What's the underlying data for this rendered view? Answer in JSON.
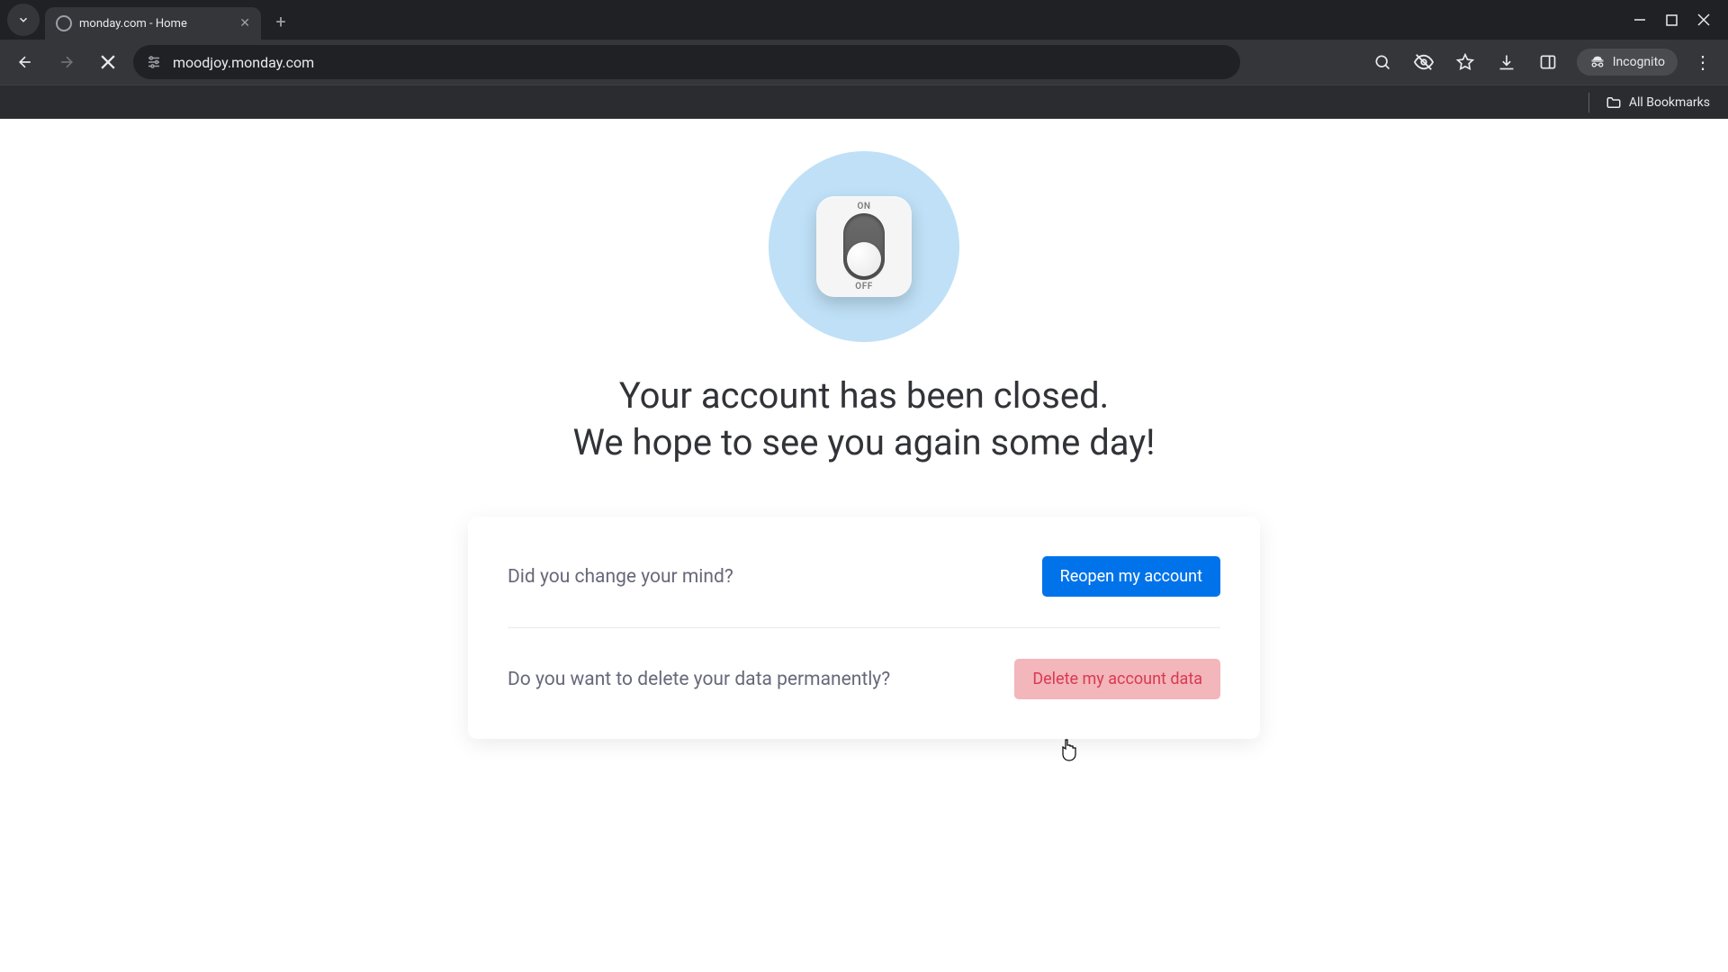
{
  "browser": {
    "tab_title": "monday.com - Home",
    "url": "moodjoy.monday.com",
    "incognito_label": "Incognito",
    "all_bookmarks_label": "All Bookmarks"
  },
  "illustration": {
    "on_label": "ON",
    "off_label": "OFF"
  },
  "headline_line1": "Your account has been closed.",
  "headline_line2": "We hope to see you again some day!",
  "card": {
    "reopen_prompt": "Did you change your mind?",
    "reopen_button": "Reopen my account",
    "delete_prompt": "Do you want to delete your data permanently?",
    "delete_button": "Delete my account data"
  },
  "colors": {
    "primary": "#0073ea",
    "danger_bg": "#f3b6bb",
    "danger_fg": "#d83a52",
    "illus_bg": "#bfe0f7"
  }
}
